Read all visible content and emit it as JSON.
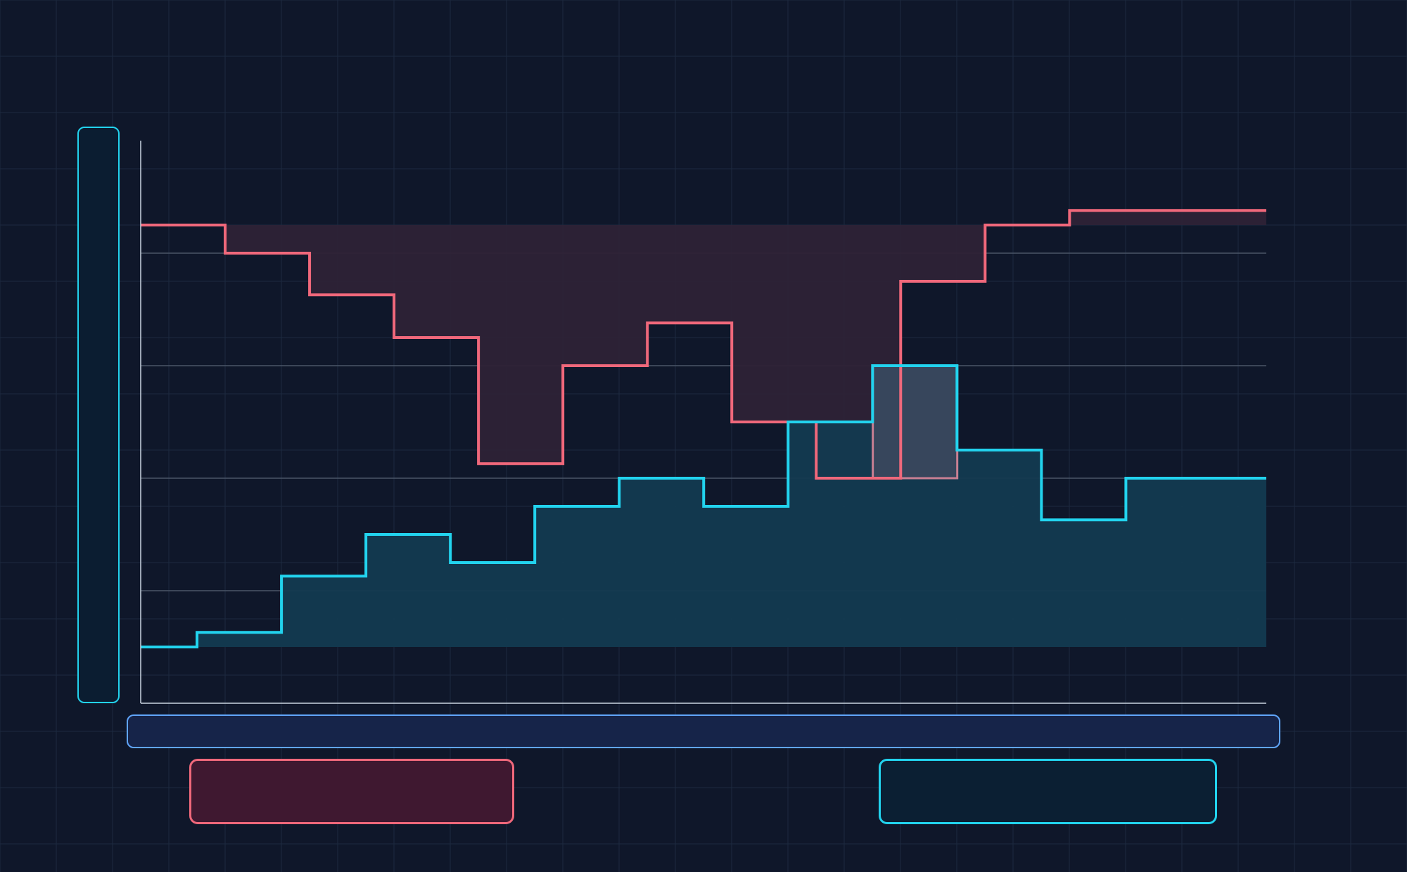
{
  "chart_data": {
    "type": "line",
    "step": true,
    "title": "",
    "xlabel": "",
    "ylabel": "",
    "x": [
      0,
      1,
      2,
      3,
      4,
      5,
      6,
      7,
      8,
      9,
      10,
      11,
      12,
      13
    ],
    "xlim": [
      0,
      13.33
    ],
    "ylim": [
      0,
      5
    ],
    "yticks": [
      1,
      2,
      3,
      4
    ],
    "grid": true,
    "legend": "bottom",
    "series": [
      {
        "color": "#f0687b",
        "fill": "#2e2236",
        "baseline": 4.25,
        "values": [
          4.25,
          4.0,
          3.63,
          3.25,
          2.13,
          3.0,
          3.38,
          2.5,
          2.0,
          3.75,
          4.25,
          4.38,
          4.38
        ]
      },
      {
        "color": "#22d3ee",
        "fill": "#133a50",
        "baseline": 0.5,
        "x_shift": -0.333,
        "values": [
          0.5,
          0.63,
          1.13,
          1.5,
          1.25,
          1.75,
          2.0,
          1.75,
          2.5,
          3.0,
          2.25,
          1.63,
          2.0,
          2.0
        ]
      }
    ],
    "overlap": {
      "x": [
        8.67,
        9.67
      ],
      "fill": "#37465c",
      "stroke": "#c97f93"
    }
  },
  "legend": {
    "a_label": "",
    "b_label": ""
  }
}
